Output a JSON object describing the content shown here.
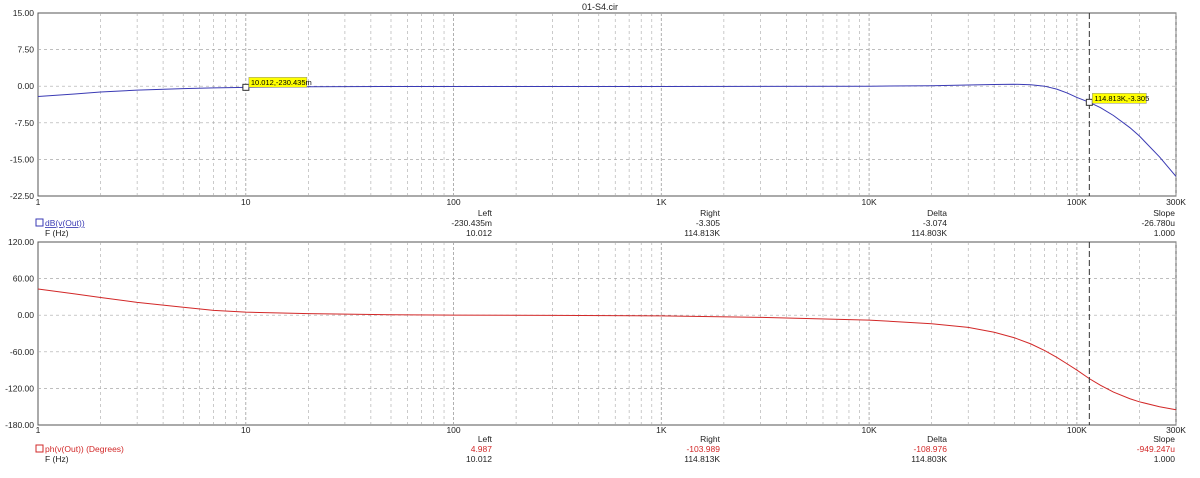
{
  "title": "01-S4.cir",
  "colors": {
    "magnitude": "#3a3ab4",
    "phase": "#d22828",
    "grid": "#a8a8a8",
    "marker_fill": "#ffff00",
    "text": "#222222"
  },
  "x_tick_labels": [
    "1",
    "10",
    "100",
    "1K",
    "10K",
    "100K",
    "300K"
  ],
  "readout_headers": {
    "left": "Left",
    "right": "Right",
    "delta": "Delta",
    "slope": "Slope"
  },
  "magnitude_readout": {
    "trace_label": "dB(v(Out))",
    "x_label": "F (Hz)",
    "left_y": "-230.435m",
    "left_x": "10.012",
    "right_y": "-3.305",
    "right_x": "114.813K",
    "delta_y": "-3.074",
    "delta_x": "114.803K",
    "slope_y": "-26.780u",
    "slope_x": "1.000"
  },
  "phase_readout": {
    "trace_label": "ph(v(Out)) (Degrees)",
    "x_label": "F (Hz)",
    "left_y": "4.987",
    "left_x": "10.012",
    "right_y": "-103.989",
    "right_x": "114.813K",
    "delta_y": "-108.976",
    "delta_x": "114.803K",
    "slope_y": "-949.247u",
    "slope_x": "1.000"
  },
  "markers": {
    "left": "10.012,-230.435m",
    "right": "114.813K,-3.305"
  },
  "chart_data": [
    {
      "type": "line",
      "x_scale": "log",
      "xlim": [
        1,
        300000
      ],
      "ylim": [
        -22.5,
        15
      ],
      "y_ticks": [
        "15.00",
        "7.50",
        "0.00",
        "-7.50",
        "-15.00",
        "-22.50"
      ],
      "series": [
        {
          "name": "dB(v(Out))",
          "x": [
            1,
            1.5,
            2,
            3,
            5,
            7,
            10,
            20,
            50,
            100,
            1000,
            10000,
            20000,
            30000,
            40000,
            50000,
            60000,
            70000,
            80000,
            90000,
            100000,
            114813,
            130000,
            150000,
            180000,
            200000,
            250000,
            300000
          ],
          "y": [
            -2.1,
            -1.6,
            -1.2,
            -0.8,
            -0.5,
            -0.35,
            -0.23,
            -0.12,
            -0.06,
            -0.05,
            -0.05,
            0.0,
            0.1,
            0.25,
            0.35,
            0.4,
            0.3,
            0.0,
            -0.6,
            -1.4,
            -2.3,
            -3.305,
            -4.4,
            -6.0,
            -8.5,
            -10.2,
            -14.5,
            -18.5
          ]
        }
      ]
    },
    {
      "type": "line",
      "x_scale": "log",
      "xlim": [
        1,
        300000
      ],
      "ylim": [
        -180,
        120
      ],
      "y_ticks": [
        "120.00",
        "60.00",
        "0.00",
        "-60.00",
        "-120.00",
        "-180.00"
      ],
      "series": [
        {
          "name": "ph(v(Out)) (Degrees)",
          "x": [
            1,
            1.5,
            2,
            3,
            5,
            7,
            10,
            20,
            50,
            100,
            300,
            1000,
            3000,
            10000,
            20000,
            30000,
            40000,
            50000,
            60000,
            70000,
            80000,
            90000,
            100000,
            114813,
            130000,
            150000,
            180000,
            200000,
            250000,
            300000
          ],
          "y": [
            43,
            35,
            29,
            21,
            13,
            8,
            4.987,
            2.5,
            0.8,
            0.2,
            -0.3,
            -1.2,
            -3.5,
            -8,
            -14,
            -20,
            -28,
            -37,
            -47,
            -58,
            -69,
            -80,
            -90,
            -103.989,
            -115,
            -126,
            -137,
            -142,
            -150,
            -155
          ]
        }
      ]
    }
  ]
}
